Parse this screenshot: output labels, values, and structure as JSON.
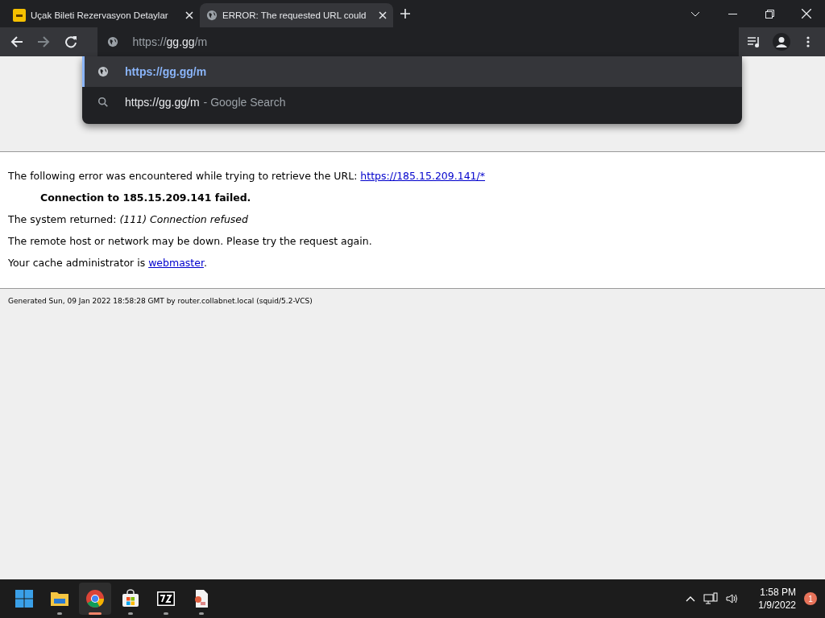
{
  "tabs": [
    {
      "kind": "site",
      "title": "Uçak Bileti Rezervasyon Detaylar",
      "selected": false
    },
    {
      "kind": "globe",
      "title": "ERROR: The requested URL could",
      "selected": true
    }
  ],
  "address": {
    "value": "https://**gg.gg**/m"
  },
  "suggestions": [
    {
      "kind": "url",
      "text": "https://gg.gg/m",
      "selected": true
    },
    {
      "kind": "search",
      "text": "https://gg.gg/m",
      "hint": "- Google Search",
      "selected": false
    }
  ],
  "page": {
    "intro": "The following error was encountered while trying to retrieve the URL:",
    "intro_link": "https://185.15.209.141/*",
    "failure": "Connection to 185.15.209.141 failed.",
    "system": "The system returned: *(111) Connection refused*",
    "advice": "The remote host or network may be down. Please try the request again.",
    "admin": "Your cache administrator is",
    "admin_link": "webmaster",
    "admin_end": ".",
    "footer": "Generated Sun, 09 Jan 2022 18:58:28 GMT by router.collabnet.local (squid/5.2-VCS)"
  },
  "taskbar": {
    "apps": [
      {
        "kind": "start",
        "running": false,
        "selected": false
      },
      {
        "kind": "files",
        "running": true,
        "selected": false
      },
      {
        "kind": "chrome",
        "running": true,
        "selected": true
      },
      {
        "kind": "store",
        "running": true,
        "selected": false
      },
      {
        "kind": "archive",
        "running": true,
        "selected": false
      },
      {
        "kind": "document",
        "running": true,
        "selected": false
      }
    ],
    "time": "1:58 PM",
    "date": "1/9/2022",
    "notifications": "1"
  }
}
